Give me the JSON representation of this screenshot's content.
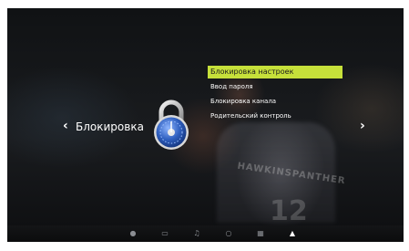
{
  "menu": {
    "title": "Блокировка",
    "left_arrow_icon": "chevron-left-icon",
    "right_arrow_icon": "chevron-right-icon",
    "category_icon": "lock-icon",
    "items": [
      {
        "label": "Блокировка настроек",
        "selected": true
      },
      {
        "label": "Ввод пароля",
        "selected": false
      },
      {
        "label": "Блокировка канала",
        "selected": false
      },
      {
        "label": "Родительский контроль",
        "selected": false
      }
    ],
    "highlight_color": "#c6e03a"
  },
  "taskbar": {
    "icons": [
      "picture-icon",
      "monitor-icon",
      "music-icon",
      "settings-icon",
      "grid-icon",
      "lock-icon"
    ],
    "active": "lock-icon"
  },
  "background": {
    "jersey_text": "HAWKINSPANTHER",
    "jersey_number": "12"
  }
}
